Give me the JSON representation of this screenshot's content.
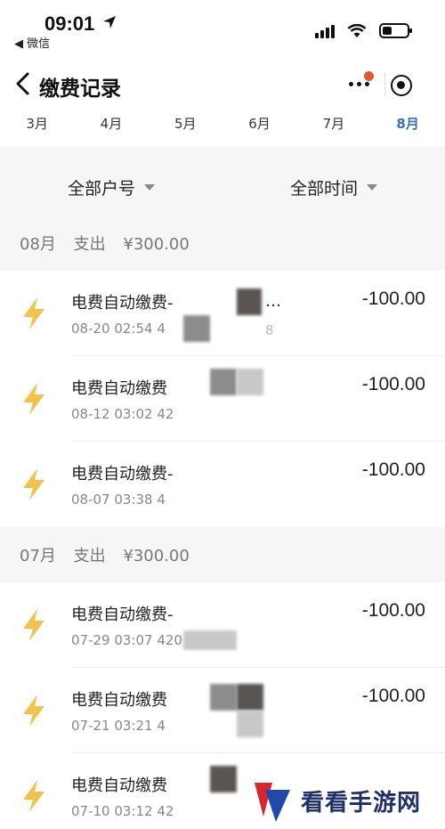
{
  "status_bar": {
    "time": "09:01",
    "back_app": "◀ 微信"
  },
  "navbar": {
    "title": "缴费记录",
    "more_icon": "ellipsis-icon",
    "close_icon": "target-circle-icon"
  },
  "months": [
    {
      "label": "3月",
      "active": false
    },
    {
      "label": "4月",
      "active": false
    },
    {
      "label": "5月",
      "active": false
    },
    {
      "label": "6月",
      "active": false
    },
    {
      "label": "7月",
      "active": false
    },
    {
      "label": "8月",
      "active": true
    }
  ],
  "filters": {
    "account": "全部户号",
    "time": "全部时间"
  },
  "groups": [
    {
      "month": "08月",
      "label": "支出",
      "total": "¥300.00",
      "records": [
        {
          "title": "电费自动缴费-",
          "time": "08-20 02:54 4",
          "amount": "-100.00",
          "extra": "…",
          "tail": "8"
        },
        {
          "title": "电费自动缴费",
          "time": "08-12 03:02 42",
          "amount": "-100.00",
          "extra": "",
          "tail": ""
        },
        {
          "title": "电费自动缴费-",
          "time": "08-07 03:38 4",
          "amount": "-100.00",
          "extra": "",
          "tail": ""
        }
      ]
    },
    {
      "month": "07月",
      "label": "支出",
      "total": "¥300.00",
      "records": [
        {
          "title": "电费自动缴费-",
          "time": "07-29 03:07 420",
          "amount": "-100.00",
          "extra": "",
          "tail": ""
        },
        {
          "title": "电费自动缴费",
          "time": "07-21 03:21 4",
          "amount": "-100.00",
          "extra": "",
          "tail": ""
        },
        {
          "title": "电费自动缴费",
          "time": "07-10 03:12 42",
          "amount": "",
          "extra": "",
          "tail": ""
        }
      ]
    }
  ],
  "colors": {
    "accent_tab": "#3b6fb3",
    "bolt": "#f2c14e",
    "notification_dot": "#e2592d"
  },
  "watermark": {
    "text": "看看手游网"
  }
}
